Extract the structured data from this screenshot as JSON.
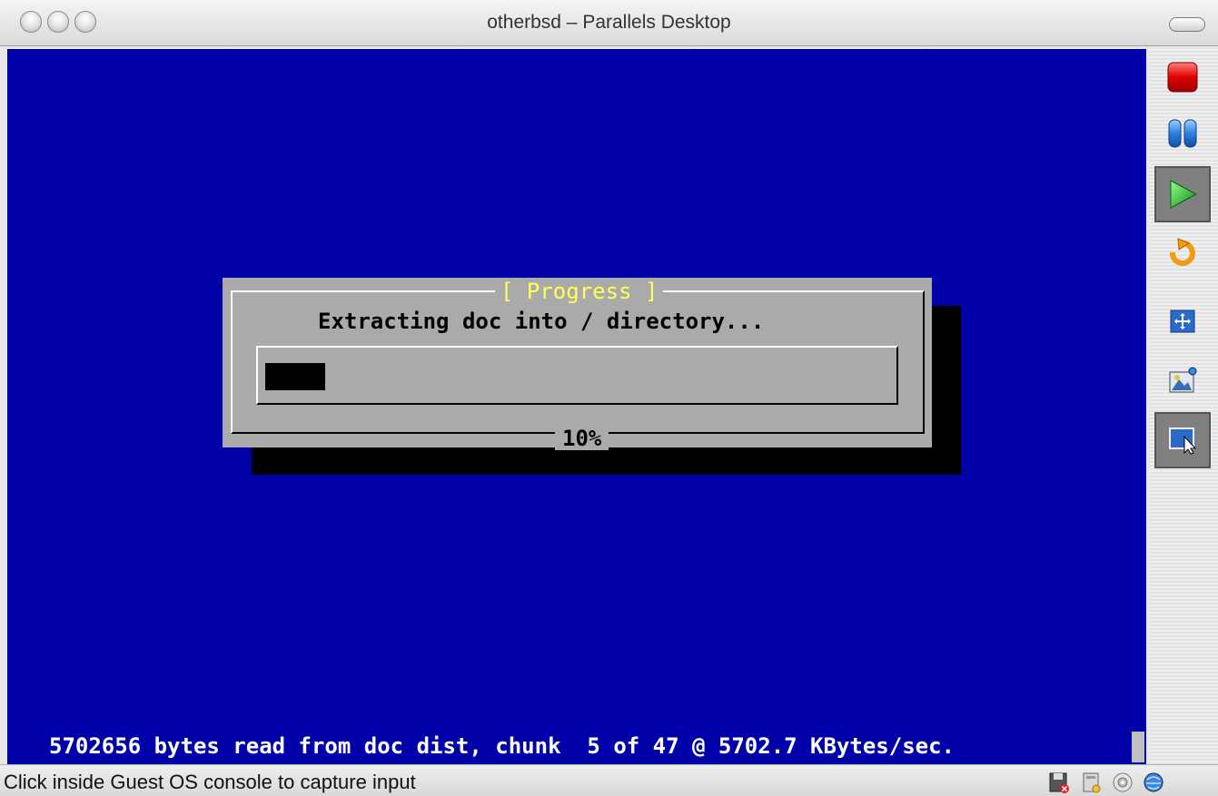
{
  "window": {
    "title": "otherbsd – Parallels Desktop"
  },
  "console": {
    "dialog": {
      "title": "[ Progress ]",
      "message": "Extracting doc into / directory...",
      "percent_label": "10%",
      "progress": 0.1
    },
    "status_line": "5702656 bytes read from doc dist, chunk  5 of 47 @ 5702.7 KBytes/sec."
  },
  "sidebar": {
    "buttons": [
      {
        "icon": "stop-icon",
        "active": false
      },
      {
        "icon": "pause-icon",
        "active": false
      },
      {
        "icon": "play-icon",
        "active": true
      },
      {
        "icon": "reset-icon",
        "active": false
      },
      {
        "icon": "fullscreen-icon",
        "active": false
      },
      {
        "icon": "screenshot-icon",
        "active": false
      },
      {
        "icon": "capture-input-icon",
        "active": true
      }
    ]
  },
  "statusbar": {
    "text": "Click inside Guest OS console to capture input",
    "icons": [
      "floppy-icon",
      "hard-disk-icon",
      "cdrom-icon",
      "network-icon"
    ]
  },
  "colors": {
    "console_bg": "#0000a8",
    "dialog_bg": "#aaaaaa",
    "dialog_title": "#ffff55"
  }
}
